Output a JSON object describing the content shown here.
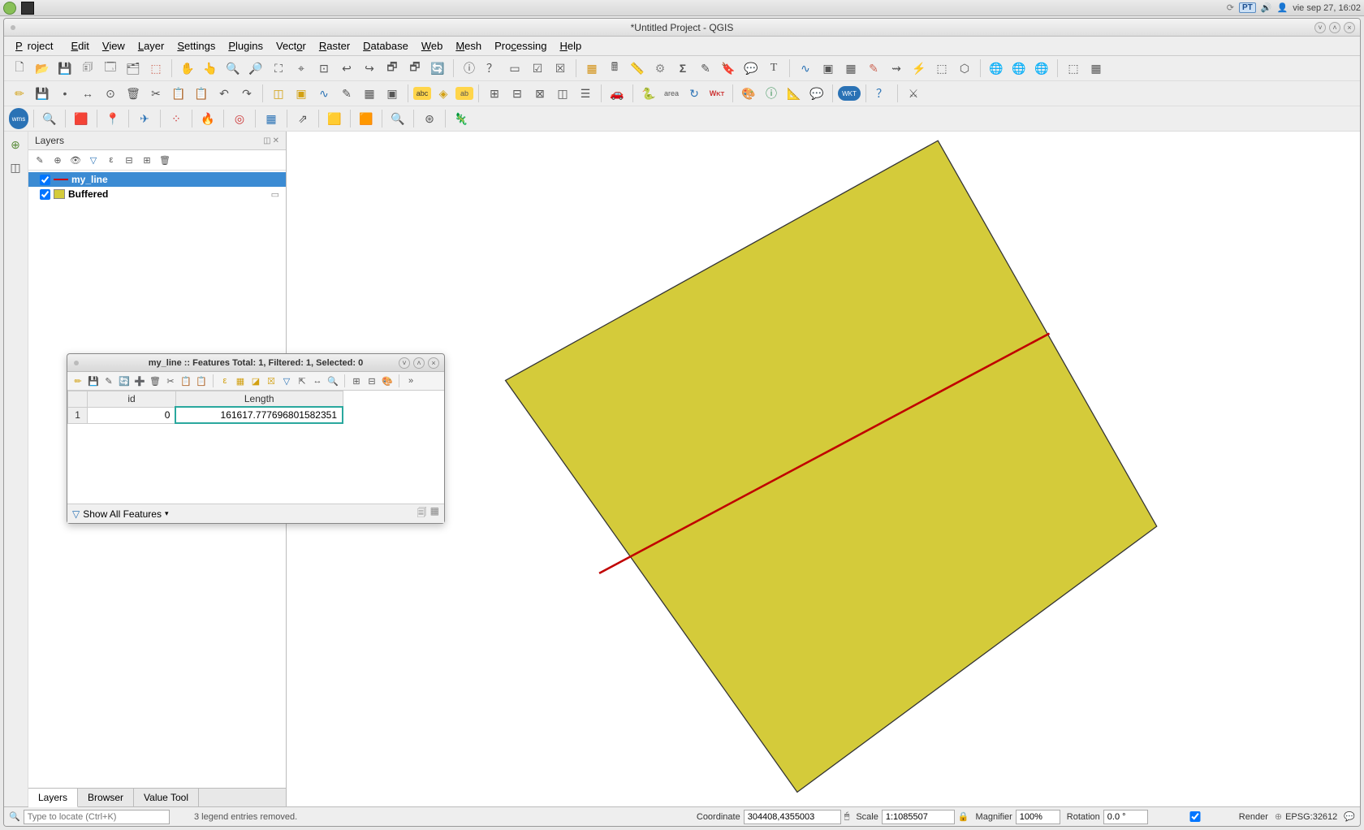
{
  "taskbar": {
    "lang_badge": "PT",
    "clock": "vie sep 27, 16:02"
  },
  "window": {
    "title": "*Untitled Project - QGIS"
  },
  "menu": {
    "project": "Project",
    "edit": "Edit",
    "view": "View",
    "layer": "Layer",
    "settings": "Settings",
    "plugins": "Plugins",
    "vector": "Vector",
    "raster": "Raster",
    "database": "Database",
    "web": "Web",
    "mesh": "Mesh",
    "processing": "Processing",
    "help": "Help"
  },
  "layers_panel": {
    "title": "Layers",
    "items": [
      {
        "checked": true,
        "name": "my_line",
        "selected": true,
        "type": "line"
      },
      {
        "checked": true,
        "name": "Buffered",
        "selected": false,
        "type": "poly"
      }
    ],
    "tabs": {
      "layers": "Layers",
      "browser": "Browser",
      "value_tool": "Value Tool"
    }
  },
  "attribute_dialog": {
    "title": "my_line :: Features Total: 1, Filtered: 1, Selected: 0",
    "columns": [
      "id",
      "Length"
    ],
    "rows": [
      {
        "row_num": "1",
        "id": "0",
        "length": "161617.777696801582351"
      }
    ],
    "footer_label": "Show All Features"
  },
  "statusbar": {
    "locate_placeholder": "Type to locate (Ctrl+K)",
    "message": "3 legend entries removed.",
    "coordinate_label": "Coordinate",
    "coordinate_value": "304408,4355003",
    "scale_label": "Scale",
    "scale_value": "1:1085507",
    "magnifier_label": "Magnifier",
    "magnifier_value": "100%",
    "rotation_label": "Rotation",
    "rotation_value": "0.0 °",
    "render_label": "Render",
    "crs": "EPSG:32612"
  }
}
